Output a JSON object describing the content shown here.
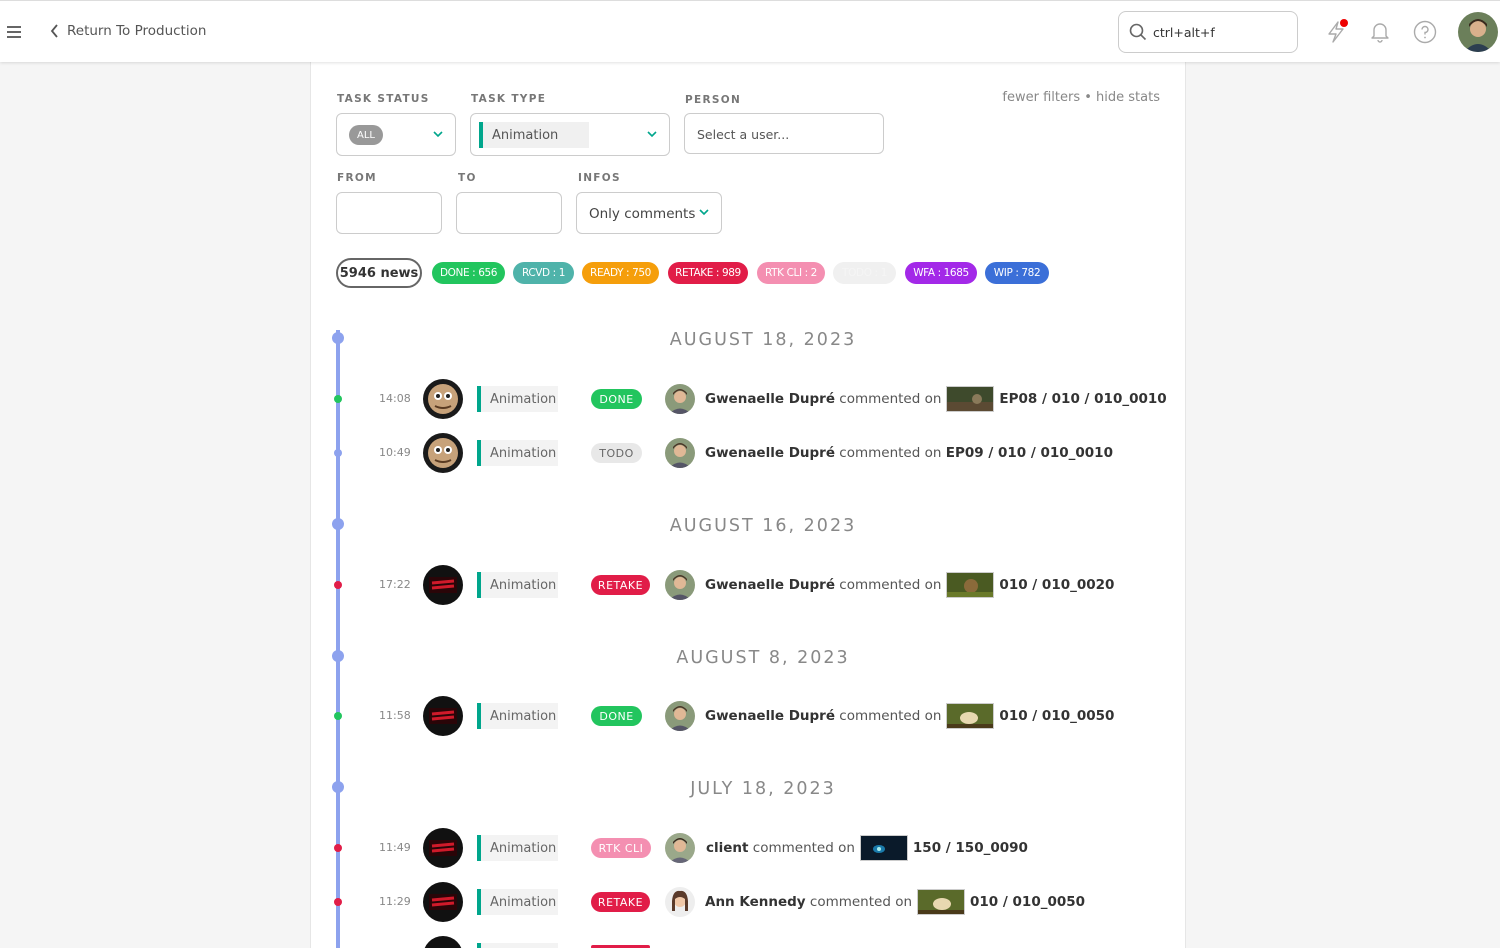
{
  "header": {
    "back_label": "Return To Production",
    "search_value": "ctrl+alt+f"
  },
  "filters": {
    "task_status_label": "TASK STATUS",
    "task_status_value": "ALL",
    "task_type_label": "TASK TYPE",
    "task_type_value": "Animation",
    "person_label": "PERSON",
    "person_placeholder": "Select a user...",
    "from_label": "FROM",
    "to_label": "TO",
    "infos_label": "INFOS",
    "infos_value": "Only comments",
    "fewer_filters": "fewer filters",
    "hide_stats": "hide stats"
  },
  "stats": {
    "news_count": "5946 news",
    "pills": [
      {
        "label": "DONE : 656",
        "color": "#22c55e"
      },
      {
        "label": "RCVD : 1",
        "color": "#4fb3aa"
      },
      {
        "label": "READY : 750",
        "color": "#f59e0b"
      },
      {
        "label": "RETAKE : 989",
        "color": "#e11d48"
      },
      {
        "label": "RTK CLI : 2",
        "color": "#f48fb1"
      },
      {
        "label": "TODO : 1",
        "color": "#f0f0f0"
      },
      {
        "label": "WFA : 1685",
        "color": "#a329e8"
      },
      {
        "label": "WIP : 782",
        "color": "#3b6fd8"
      }
    ]
  },
  "days": [
    {
      "date": "AUGUST 18, 2023",
      "rows": [
        {
          "time": "14:08",
          "type": "Animation",
          "status": "DONE",
          "user": "Gwenaelle Dupré",
          "verb": "commented on",
          "entity": "EP08 / 010 / 010_0010"
        },
        {
          "time": "10:49",
          "type": "Animation",
          "status": "TODO",
          "user": "Gwenaelle Dupré",
          "verb": "commented on",
          "entity": "EP09 / 010 / 010_0010"
        }
      ]
    },
    {
      "date": "AUGUST 16, 2023",
      "rows": [
        {
          "time": "17:22",
          "type": "Animation",
          "status": "RETAKE",
          "user": "Gwenaelle Dupré",
          "verb": "commented on",
          "entity": "010 / 010_0020"
        }
      ]
    },
    {
      "date": "AUGUST 8, 2023",
      "rows": [
        {
          "time": "11:58",
          "type": "Animation",
          "status": "DONE",
          "user": "Gwenaelle Dupré",
          "verb": "commented on",
          "entity": "010 / 010_0050"
        }
      ]
    },
    {
      "date": "JULY 18, 2023",
      "rows": [
        {
          "time": "11:49",
          "type": "Animation",
          "status": "RTK CLI",
          "user": "client",
          "verb": "commented on",
          "entity": "150 / 150_0090"
        },
        {
          "time": "11:29",
          "type": "Animation",
          "status": "RETAKE",
          "user": "Ann Kennedy",
          "verb": "commented on",
          "entity": "010 / 010_0050"
        }
      ]
    }
  ],
  "colors": {
    "accent_teal": "#00a68c",
    "timeline": "#8da2ee",
    "done": "#22c55e",
    "retake": "#e11d48",
    "rtk_cli": "#f48fb1",
    "todo": "#e8e8e8"
  },
  "icons": [
    "hamburger-icon",
    "chevron-left-icon",
    "search-icon",
    "lightning-icon",
    "bell-icon",
    "help-icon",
    "chevron-down-icon"
  ]
}
